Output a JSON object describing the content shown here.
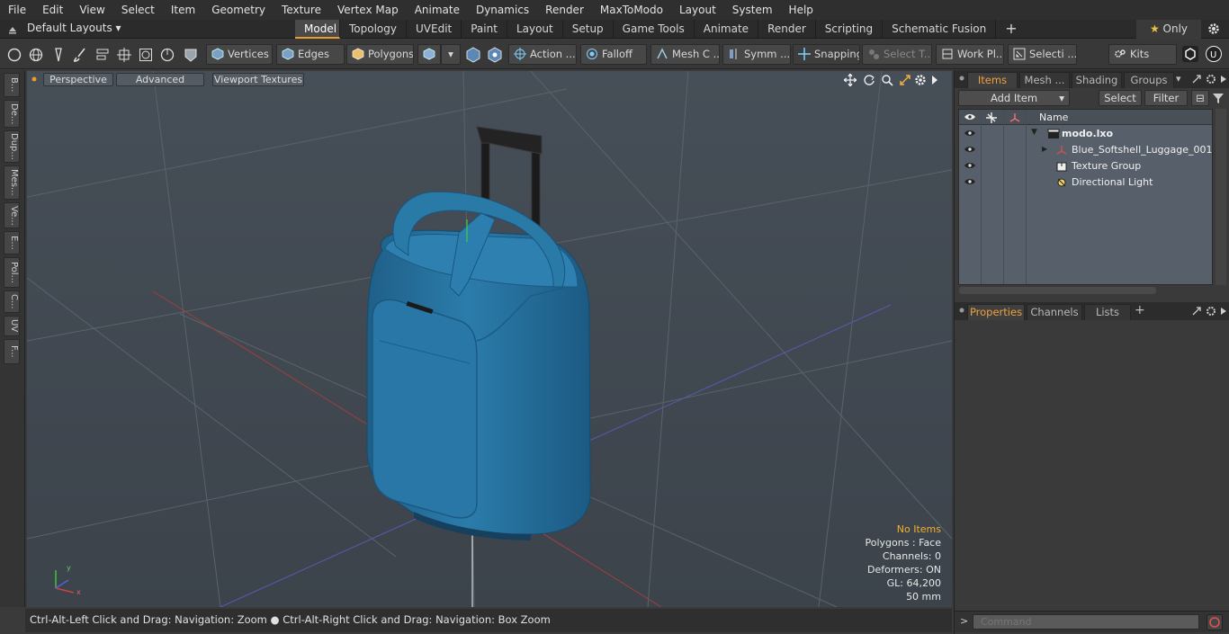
{
  "menu": [
    "File",
    "Edit",
    "View",
    "Select",
    "Item",
    "Geometry",
    "Texture",
    "Vertex Map",
    "Animate",
    "Dynamics",
    "Render",
    "MaxToModo",
    "Layout",
    "System",
    "Help"
  ],
  "layout_selector": "Default Layouts",
  "layout_tabs": [
    "Model",
    "Topology",
    "UVEdit",
    "Paint",
    "Layout",
    "Setup",
    "Game Tools",
    "Animate",
    "Render",
    "Scripting",
    "Schematic Fusion"
  ],
  "active_tab": "Model",
  "only_label": "Only",
  "toolbar": {
    "vertices": "Vertices",
    "edges": "Edges",
    "polygons": "Polygons",
    "action": "Action ...",
    "falloff": "Falloff",
    "mesh": "Mesh C ...",
    "symm": "Symm ...",
    "snapping": "Snapping",
    "select_t": "Select T...",
    "workpl": "Work Pl...",
    "selecti": "Selecti ...",
    "kits": "Kits"
  },
  "left_tabs": [
    "B...",
    "De...",
    "Dup...",
    "Mes...",
    "Ve...",
    "E...",
    "Pol...",
    "C...",
    "UV",
    "F..."
  ],
  "viewport": {
    "perspective": "Perspective",
    "advanced": "Advanced",
    "viewport_textures": "Viewport Textures",
    "stats": {
      "no_items": "No Items",
      "polygons": "Polygons : Face",
      "channels": "Channels: 0",
      "deformers": "Deformers: ON",
      "gl": "GL: 64,200",
      "scale": "50 mm"
    }
  },
  "status_bar": {
    "left": "Ctrl-Alt-Left Click and Drag: Navigation: Zoom",
    "right": "Ctrl-Alt-Right Click and Drag: Navigation: Box Zoom"
  },
  "items_panel": {
    "tabs": [
      "Items",
      "Mesh ...",
      "Shading",
      "Groups"
    ],
    "add_item": "Add Item",
    "select": "Select",
    "filter": "Filter",
    "column_name": "Name",
    "tree": [
      {
        "label": "modo.lxo",
        "indent": 0
      },
      {
        "label": "Blue_Softshell_Luggage_001",
        "indent": 1
      },
      {
        "label": "Texture Group",
        "indent": 1
      },
      {
        "label": "Directional Light",
        "indent": 1
      }
    ]
  },
  "properties_panel": {
    "tabs": [
      "Properties",
      "Channels",
      "Lists"
    ]
  },
  "command": {
    "placeholder": "Command"
  },
  "colors": {
    "accent": "#e89a2a",
    "viewport_bg": "#424a52",
    "luggage": "#2a7aa8"
  }
}
